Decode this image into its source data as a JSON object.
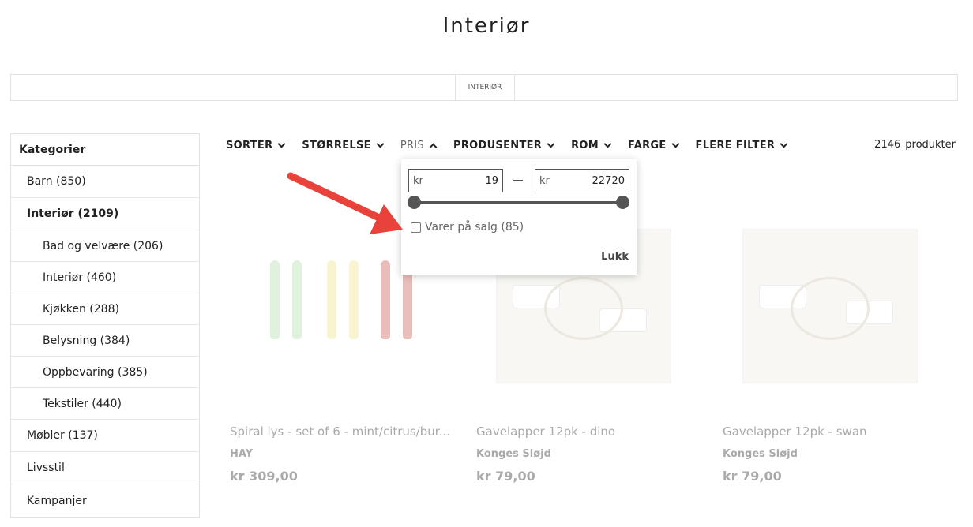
{
  "page": {
    "title": "Interiør"
  },
  "breadcrumb": {
    "current": "INTERIØR"
  },
  "sidebar": {
    "heading": "Kategorier",
    "items": [
      {
        "label": "Barn (850)",
        "level": 0,
        "active": false
      },
      {
        "label": "Interiør (2109)",
        "level": 0,
        "active": true
      },
      {
        "label": "Bad og velvære (206)",
        "level": 1,
        "active": false
      },
      {
        "label": "Interiør (460)",
        "level": 1,
        "active": false
      },
      {
        "label": "Kjøkken (288)",
        "level": 1,
        "active": false
      },
      {
        "label": "Belysning (384)",
        "level": 1,
        "active": false
      },
      {
        "label": "Oppbevaring (385)",
        "level": 1,
        "active": false
      },
      {
        "label": "Tekstiler (440)",
        "level": 1,
        "active": false
      },
      {
        "label": "Møbler (137)",
        "level": 0,
        "active": false
      },
      {
        "label": "Livsstil",
        "level": 0,
        "active": false
      },
      {
        "label": "Kampanjer",
        "level": 0,
        "active": false
      }
    ]
  },
  "filters": {
    "sort": "SORTER",
    "size": "STØRRELSE",
    "price": "PRIS",
    "producer": "PRODUSENTER",
    "room": "ROM",
    "color": "FARGE",
    "more": "FLERE FILTER"
  },
  "result_count": {
    "value": "2146",
    "unit": "produkter"
  },
  "price_dropdown": {
    "currency": "kr",
    "min": "19",
    "max": "22720",
    "sale_label": "Varer på salg (85)",
    "sale_checked": false,
    "close_label": "Lukk"
  },
  "products": [
    {
      "name": "Spiral lys - set of 6 - mint/citrus/bur...",
      "brand": "HAY",
      "price": "kr 309,00"
    },
    {
      "name": "Gavelapper 12pk - dino",
      "brand": "Konges Sløjd",
      "price": "kr 79,00"
    },
    {
      "name": "Gavelapper 12pk - swan",
      "brand": "Konges Sløjd",
      "price": "kr 79,00"
    }
  ],
  "colors": {
    "annotation_arrow": "#e8423a",
    "text": "#222222",
    "border": "#e2e2e2"
  }
}
